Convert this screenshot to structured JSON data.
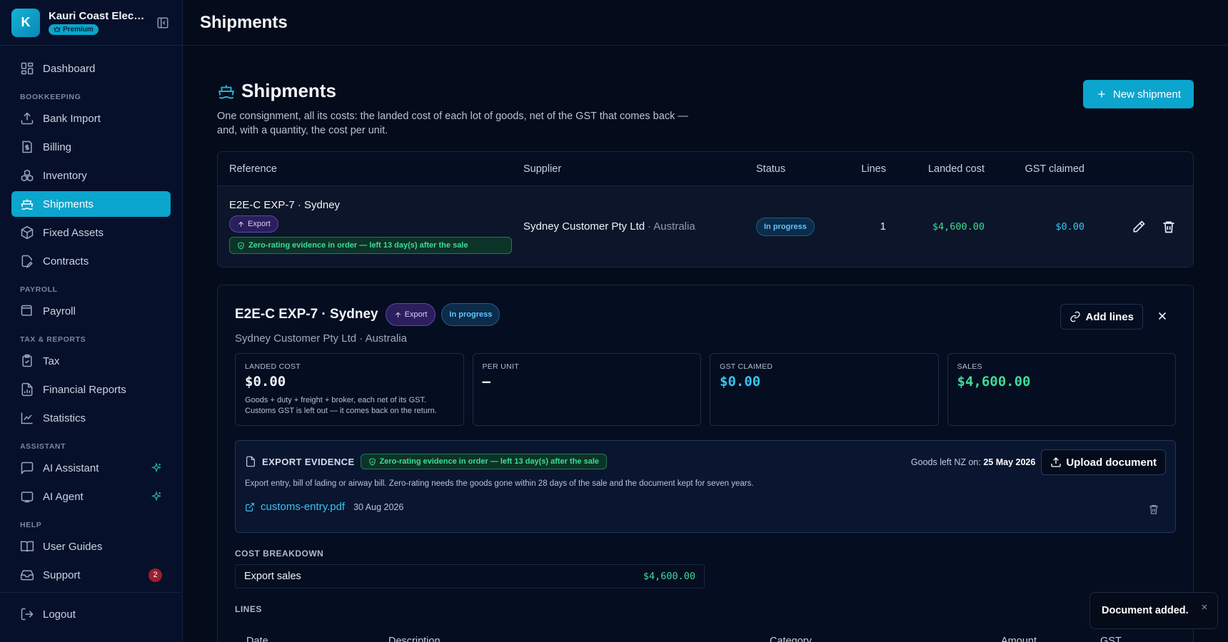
{
  "sidebar": {
    "org_initial": "K",
    "org_name": "Kauri Coast Electri...",
    "plan_badge": "Premium",
    "items": [
      {
        "label": "Dashboard",
        "icon": "dashboard-icon"
      },
      {
        "section": "BOOKKEEPING"
      },
      {
        "label": "Bank Import",
        "icon": "upload-icon"
      },
      {
        "label": "Billing",
        "icon": "invoice-icon"
      },
      {
        "label": "Inventory",
        "icon": "boxes-icon"
      },
      {
        "label": "Shipments",
        "icon": "ship-icon",
        "active": true
      },
      {
        "label": "Fixed Assets",
        "icon": "package-icon"
      },
      {
        "label": "Contracts",
        "icon": "contract-icon"
      },
      {
        "section": "PAYROLL"
      },
      {
        "label": "Payroll",
        "icon": "wallet-icon"
      },
      {
        "section": "TAX & REPORTS"
      },
      {
        "label": "Tax",
        "icon": "clipboard-icon"
      },
      {
        "label": "Financial Reports",
        "icon": "report-icon"
      },
      {
        "label": "Statistics",
        "icon": "chart-line-icon"
      },
      {
        "section": "ASSISTANT"
      },
      {
        "label": "AI Assistant",
        "icon": "chat-icon",
        "sparkle": true
      },
      {
        "label": "AI Agent",
        "icon": "bot-icon",
        "sparkle": true
      },
      {
        "section": "HELP"
      },
      {
        "label": "User Guides",
        "icon": "book-icon"
      },
      {
        "label": "Support",
        "icon": "inbox-icon",
        "badge": "2"
      }
    ],
    "logout_label": "Logout"
  },
  "topbar": {
    "title": "Shipments"
  },
  "page": {
    "title": "Shipments",
    "description": "One consignment, all its costs: the landed cost of each lot of goods, net of the GST that comes back — and, with a quantity, the cost per unit.",
    "new_button": "New shipment"
  },
  "table": {
    "headers": [
      "Reference",
      "Supplier",
      "Status",
      "Lines",
      "Landed cost",
      "GST claimed"
    ],
    "row": {
      "reference": "E2E-C EXP-7 · Sydney",
      "export_chip": "Export",
      "evidence_chip": "Zero-rating evidence in order — left 13 day(s) after the sale",
      "supplier": "Sydney Customer Pty Ltd",
      "country": "· Australia",
      "status": "In progress",
      "lines": "1",
      "landed_cost": "$4,600.00",
      "gst_claimed": "$0.00"
    }
  },
  "detail": {
    "title": "E2E-C EXP-7 · Sydney",
    "export_chip": "Export",
    "status_chip": "In progress",
    "subtitle": "Sydney Customer Pty Ltd · Australia",
    "add_lines_button": "Add lines",
    "stats": {
      "landed": {
        "label": "LANDED COST",
        "value": "$0.00",
        "note": "Goods + duty + freight + broker, each net of its GST. Customs GST is left out — it comes back on the return."
      },
      "per_unit": {
        "label": "PER UNIT",
        "value": "—"
      },
      "gst": {
        "label": "GST CLAIMED",
        "value": "$0.00"
      },
      "sales": {
        "label": "SALES",
        "value": "$4,600.00"
      }
    },
    "evidence": {
      "title": "EXPORT EVIDENCE",
      "chip": "Zero-rating evidence in order — left 13 day(s) after the sale",
      "goods_left_label": "Goods left NZ on:",
      "goods_left_date": "25 May 2026",
      "upload_button": "Upload document",
      "description": "Export entry, bill of lading or airway bill. Zero-rating needs the goods gone within 28 days of the sale and the document kept for seven years.",
      "file_name": "customs-entry.pdf",
      "file_date": "30 Aug 2026"
    },
    "cost_breakdown": {
      "title": "COST BREAKDOWN",
      "label": "Export sales",
      "amount": "$4,600.00"
    },
    "lines": {
      "title": "LINES",
      "headers": [
        "Date",
        "Description",
        "Category",
        "Amount",
        "GST"
      ]
    }
  },
  "toast": {
    "message": "Document added."
  },
  "colors": {
    "accent": "#0ba5ce",
    "green": "#3ddc97",
    "cyan": "#35c6f0",
    "background": "#040b1a"
  }
}
